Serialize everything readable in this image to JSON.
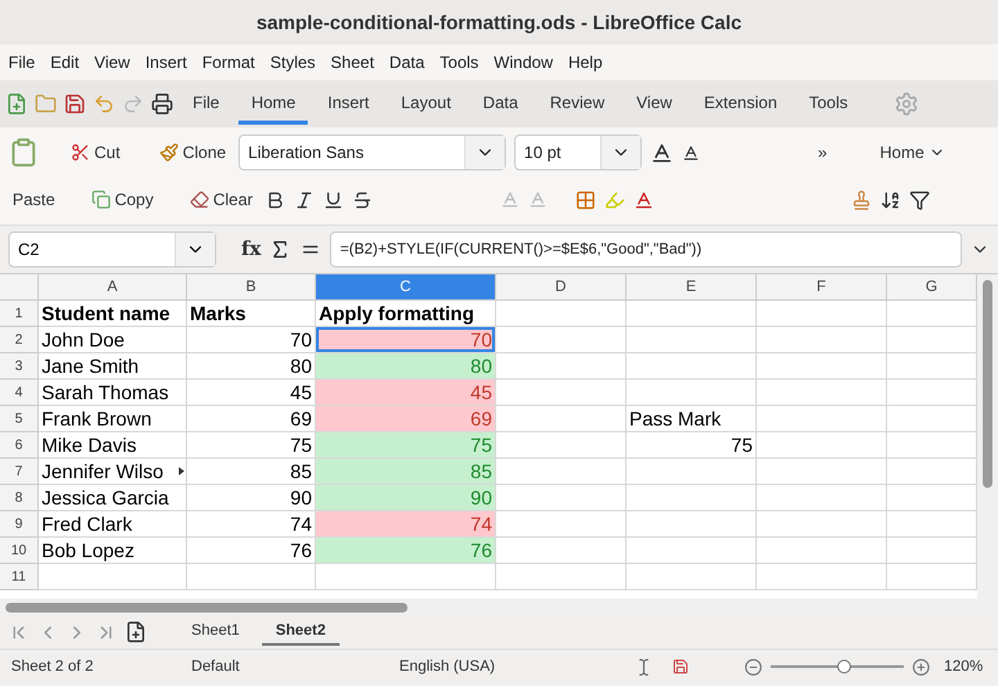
{
  "window": {
    "title": "sample-conditional-formatting.ods - LibreOffice Calc"
  },
  "menu": [
    "File",
    "Edit",
    "View",
    "Insert",
    "Format",
    "Styles",
    "Sheet",
    "Data",
    "Tools",
    "Window",
    "Help"
  ],
  "tabs": [
    {
      "label": "File",
      "selected": false
    },
    {
      "label": "Home",
      "selected": true
    },
    {
      "label": "Insert",
      "selected": false
    },
    {
      "label": "Layout",
      "selected": false
    },
    {
      "label": "Data",
      "selected": false
    },
    {
      "label": "Review",
      "selected": false
    },
    {
      "label": "View",
      "selected": false
    },
    {
      "label": "Extension",
      "selected": false
    },
    {
      "label": "Tools",
      "selected": false
    }
  ],
  "toolbar": {
    "paste": "Paste",
    "cut": "Cut",
    "copy": "Copy",
    "clone": "Clone",
    "clear": "Clear",
    "font_name": "Liberation Sans",
    "font_size": "10 pt",
    "more": "»",
    "context": "Home"
  },
  "formula_bar": {
    "name_box": "C2",
    "function_wizard": "fx",
    "formula": "=(B2)+STYLE(IF(CURRENT()>=$E$6,\"Good\",\"Bad\"))"
  },
  "columns": [
    {
      "label": "A",
      "selected": false
    },
    {
      "label": "B",
      "selected": false
    },
    {
      "label": "C",
      "selected": true
    },
    {
      "label": "D",
      "selected": false
    },
    {
      "label": "E",
      "selected": false
    },
    {
      "label": "F",
      "selected": false
    },
    {
      "label": "G",
      "selected": false
    }
  ],
  "rows": [
    {
      "number": "1",
      "header": true,
      "name": "Student name",
      "marks": "Marks",
      "formatted": {
        "text": "Apply formatting",
        "kind": "plain",
        "selected": false
      }
    },
    {
      "number": "2",
      "header": false,
      "name": "John Doe",
      "marks": "70",
      "formatted": {
        "text": "70",
        "kind": "bad",
        "selected": true
      }
    },
    {
      "number": "3",
      "header": false,
      "name": "Jane Smith",
      "marks": "80",
      "formatted": {
        "text": "80",
        "kind": "good",
        "selected": false
      }
    },
    {
      "number": "4",
      "header": false,
      "name": "Sarah Thomas",
      "marks": "45",
      "formatted": {
        "text": "45",
        "kind": "bad",
        "selected": false
      }
    },
    {
      "number": "5",
      "header": false,
      "name": "Frank Brown",
      "marks": "69",
      "formatted": {
        "text": "69",
        "kind": "bad",
        "selected": false
      },
      "column_e": "Pass Mark"
    },
    {
      "number": "6",
      "header": false,
      "name": "Mike Davis",
      "marks": "75",
      "formatted": {
        "text": "75",
        "kind": "good",
        "selected": false
      },
      "column_e": "75"
    },
    {
      "number": "7",
      "header": false,
      "name": "Jennifer Wilso",
      "overflow": true,
      "marks": "85",
      "formatted": {
        "text": "85",
        "kind": "good",
        "selected": false
      }
    },
    {
      "number": "8",
      "header": false,
      "name": "Jessica Garcia",
      "marks": "90",
      "formatted": {
        "text": "90",
        "kind": "good",
        "selected": false
      }
    },
    {
      "number": "9",
      "header": false,
      "name": "Fred Clark",
      "marks": "74",
      "formatted": {
        "text": "74",
        "kind": "bad",
        "selected": false
      }
    },
    {
      "number": "10",
      "header": false,
      "name": "Bob Lopez",
      "marks": "76",
      "formatted": {
        "text": "76",
        "kind": "good",
        "selected": false
      }
    },
    {
      "number": "11"
    }
  ],
  "sheets": [
    {
      "label": "Sheet1",
      "selected": false
    },
    {
      "label": "Sheet2",
      "selected": true
    }
  ],
  "status_bar": {
    "sheet": "Sheet 2 of 2",
    "page_style": "Default",
    "language": "English (USA)",
    "zoom": "120%",
    "zoom_slider": {
      "level": 0.55
    }
  }
}
